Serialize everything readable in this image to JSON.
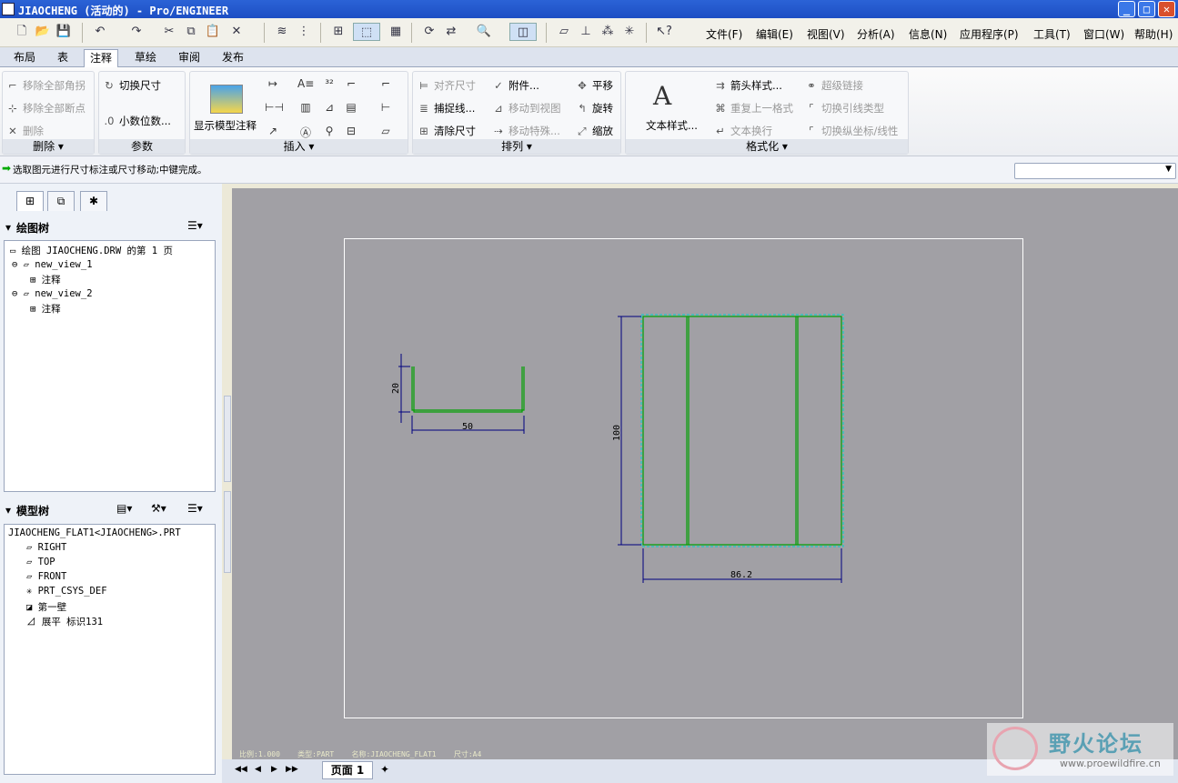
{
  "window": {
    "title": "JIAOCHENG (活动的) - Pro/ENGINEER"
  },
  "menu": [
    "文件(F)",
    "编辑(E)",
    "视图(V)",
    "分析(A)",
    "信息(N)",
    "应用程序(P)",
    "工具(T)",
    "窗口(W)",
    "帮助(H)"
  ],
  "tabs": [
    "布局",
    "表",
    "注释",
    "草绘",
    "审阅",
    "发布"
  ],
  "active_tab": "注释",
  "ribbon": {
    "delete_group": {
      "label": "删除",
      "items": [
        "移除全部角拐",
        "移除全部断点",
        "删除"
      ]
    },
    "params_group": {
      "label": "参数",
      "items": [
        "切换尺寸",
        "小数位数..."
      ]
    },
    "insert_group": {
      "label": "插入",
      "show_model": "显示模型注释"
    },
    "arrange_group": {
      "label": "排列",
      "items": [
        "对齐尺寸",
        "捕捉线...",
        "清除尺寸",
        "附件...",
        "移动到视图",
        "移动特殊...",
        "平移",
        "旋转",
        "缩放"
      ]
    },
    "format_group": {
      "label": "格式化",
      "text_style": "文本样式...",
      "items": [
        "箭头样式...",
        "重复上一格式",
        "文本换行",
        "超级链接",
        "切换引线类型",
        "切换纵坐标/线性"
      ]
    }
  },
  "status": {
    "message": "选取图元进行尺寸标注或尺寸移动;中键完成。"
  },
  "drawing_tree": {
    "title": "绘图树",
    "nodes": [
      "绘图 JIAOCHENG.DRW 的第 1 页",
      "new_view_1",
      "注释",
      "new_view_2",
      "注释"
    ]
  },
  "model_tree": {
    "title": "模型树",
    "nodes": [
      "JIAOCHENG_FLAT1<JIAOCHENG>.PRT",
      "RIGHT",
      "TOP",
      "FRONT",
      "PRT_CSYS_DEF",
      "第一壁",
      "展平 标识131"
    ]
  },
  "drawing": {
    "dims": {
      "view1_height": "20",
      "view1_width": "50",
      "view2_height": "100",
      "view2_width": "86.2"
    },
    "footer": "比例:1.000    类型:PART    名称:JIAOCHENG_FLAT1    尺寸:A4"
  },
  "bottom": {
    "page_tab": "页面 1"
  },
  "watermark": {
    "title": "野火论坛",
    "url": "www.proewildfire.cn"
  },
  "colors": {
    "geometry": "#00a000",
    "selection": "#00d0d0",
    "title_bar": "#2b63d6"
  }
}
